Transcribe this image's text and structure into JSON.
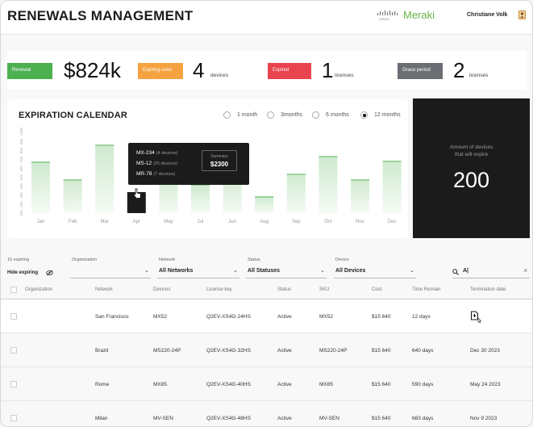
{
  "header": {
    "title": "RENEWALS MANAGEMENT",
    "brand": "Meraki",
    "user": "Christiane Volk"
  },
  "kpis": [
    {
      "badge": "Renewal",
      "value": "$824k",
      "unit": "",
      "color": "#4caf50"
    },
    {
      "badge": "Expiring soon",
      "value": "4",
      "unit": "devices",
      "color": "#f4a340"
    },
    {
      "badge": "Expired",
      "value": "1",
      "unit": "licenses",
      "color": "#e8434e"
    },
    {
      "badge": "Grace period",
      "value": "2",
      "unit": "licenses",
      "color": "#6b6e73"
    }
  ],
  "calendar": {
    "title": "EXPIRATION CALENDAR",
    "periods": [
      "1 month",
      "3months",
      "6 months",
      "12 months"
    ],
    "selected_period": "12 months",
    "tooltip": {
      "lines": [
        {
          "model": "MX-234",
          "note": "(4 devices)"
        },
        {
          "model": "MS-12",
          "note": "(25 devices)"
        },
        {
          "model": "MR-78",
          "note": "(7 devices)"
        }
      ],
      "summary_label": "Summary",
      "summary_value": "$2300"
    }
  },
  "chart_data": {
    "type": "bar",
    "categories": [
      "Jan",
      "Feb",
      "Mar",
      "Apr",
      "May",
      "Jul",
      "Jun",
      "Aug",
      "Sep",
      "Oct",
      "Nov",
      "Dec"
    ],
    "values": [
      640,
      420,
      850,
      260,
      470,
      360,
      500,
      210,
      490,
      710,
      420,
      650
    ],
    "yticks": [
      "1000",
      "900",
      "800",
      "700",
      "600",
      "500",
      "400",
      "300",
      "200",
      "100"
    ],
    "ylim": [
      0,
      1000
    ],
    "highlight": "Apr",
    "bar_color": "#e9f5e9"
  },
  "devices_card": {
    "label_line1": "Amount of devices",
    "label_line2": "that will expire",
    "value": "200"
  },
  "filters": {
    "expiring_count": "15 expiring",
    "hide_expiring": "Hide expiring",
    "organization_label": "Organization",
    "organization_value": "",
    "network_label": "Network",
    "network_value": "All Networks",
    "status_label": "Status",
    "status_value": "All Statuses",
    "device_label": "Device",
    "device_value": "All Devices",
    "search_value": "A|"
  },
  "table": {
    "columns": [
      "Organization",
      "Network",
      "Devices",
      "License key",
      "Status",
      "SKU",
      "Cost",
      "Time Remain",
      "Termination date"
    ],
    "rows": [
      {
        "network": "San Francisco",
        "device": "MX52",
        "key": "Q2EV-XS4G-24HS",
        "status": "Active",
        "sku": "MX52",
        "cost": "$15 640",
        "remain": "12 days",
        "term": ""
      },
      {
        "network": "Brazil",
        "device": "MS220-24P",
        "key": "Q2EV-XS4G-32HS",
        "status": "Active",
        "sku": "MS220-24P",
        "cost": "$15 640",
        "remain": "640 days",
        "term": "Dec 30 2023"
      },
      {
        "network": "Rome",
        "device": "MX85",
        "key": "Q2EV-XS4G-40HS",
        "status": "Active",
        "sku": "MX85",
        "cost": "$15 640",
        "remain": "590 days",
        "term": "May 24 2023"
      },
      {
        "network": "Milan",
        "device": "MV-SEN",
        "key": "Q2EV-XS4G-48HS",
        "status": "Active",
        "sku": "MV-SEN",
        "cost": "$15 640",
        "remain": "683 days",
        "term": "Nov 9 2023"
      }
    ]
  }
}
